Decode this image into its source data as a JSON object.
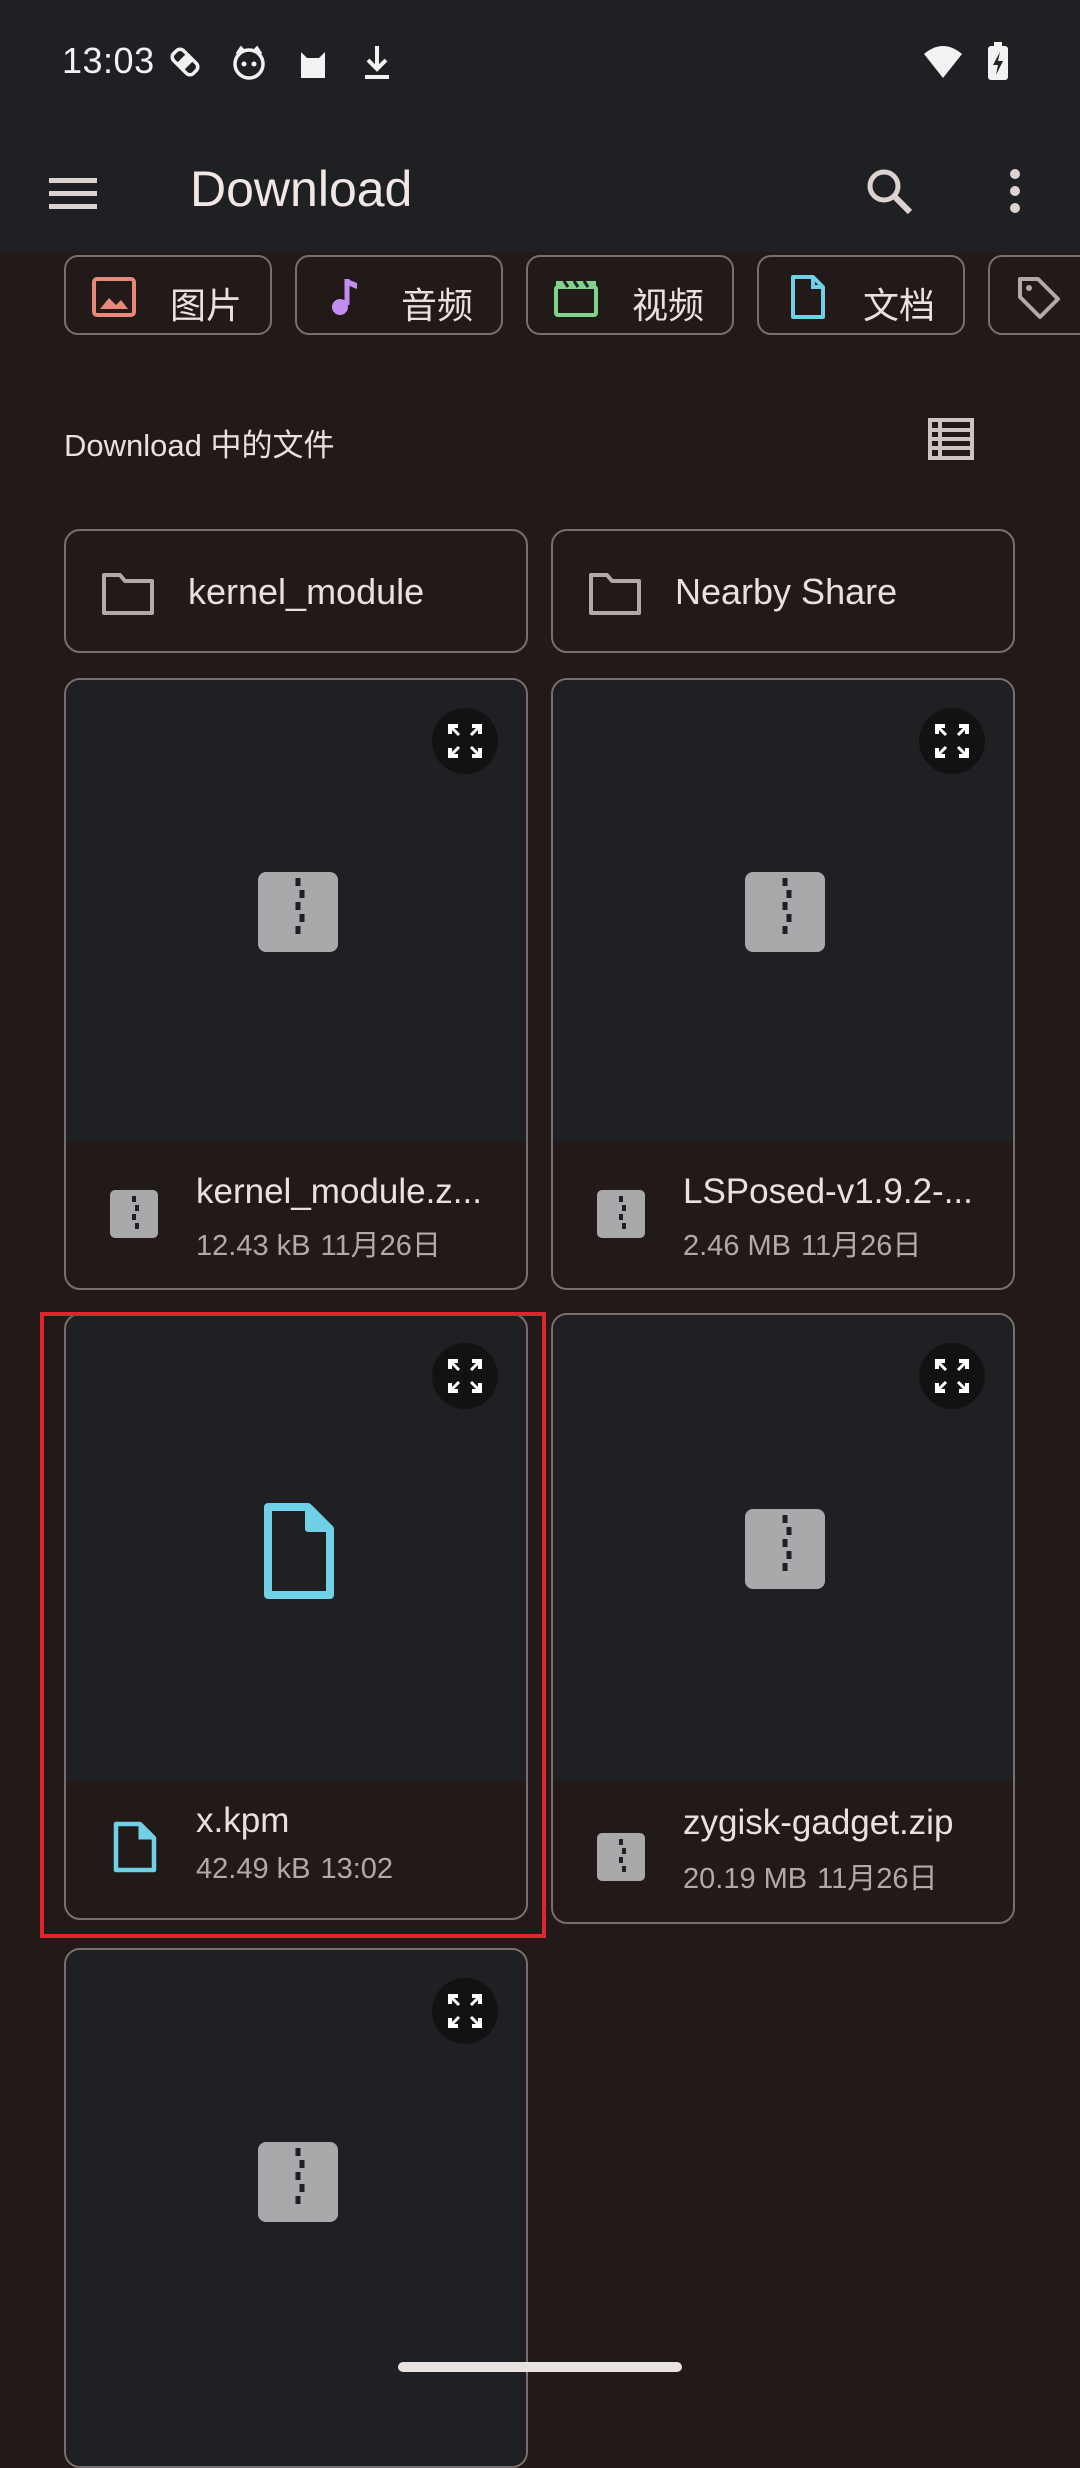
{
  "status_bar": {
    "time": "13:03",
    "icons": [
      "bandage-icon",
      "cat-face-icon",
      "cat-icon",
      "download-icon"
    ],
    "right_icons": [
      "wifi-icon",
      "battery-charging-icon"
    ]
  },
  "app_bar": {
    "title": "Download",
    "menu_icon": "hamburger-menu-icon",
    "search_icon": "search-icon",
    "more_icon": "more-vert-icon"
  },
  "filter_chips": [
    {
      "label": "图片",
      "icon": "image-icon",
      "color": "#e8887a"
    },
    {
      "label": "音频",
      "icon": "music-note-icon",
      "color": "#c48df0"
    },
    {
      "label": "视频",
      "icon": "video-icon",
      "color": "#7fd48c"
    },
    {
      "label": "文档",
      "icon": "document-icon",
      "color": "#6fd0e6"
    },
    {
      "label": "",
      "icon": "tag-icon",
      "color": "#b4a9a7"
    }
  ],
  "section": {
    "title": "Download 中的文件",
    "view_toggle_icon": "list-view-icon"
  },
  "folders": [
    {
      "name": "kernel_module"
    },
    {
      "name": "Nearby Share"
    }
  ],
  "files": [
    {
      "name": "kernel_module.z...",
      "size": "12.43 kB",
      "date": "11月26日",
      "type": "zip"
    },
    {
      "name": "LSPosed-v1.9.2-...",
      "size": "2.46 MB",
      "date": "11月26日",
      "type": "zip"
    },
    {
      "name": "x.kpm",
      "size": "42.49 kB",
      "date": "13:02",
      "type": "document"
    },
    {
      "name": "zygisk-gadget.zip",
      "size": "20.19 MB",
      "date": "11月26日",
      "type": "zip"
    },
    {
      "name": "",
      "size": "",
      "date": "",
      "type": "zip"
    }
  ],
  "colors": {
    "background": "#221919",
    "appbar": "#1f2024",
    "outline": "#7a6f6d",
    "zip_icon": "#a9a9ac",
    "doc_icon": "#6fd0e6",
    "highlight": "#e0262d"
  }
}
